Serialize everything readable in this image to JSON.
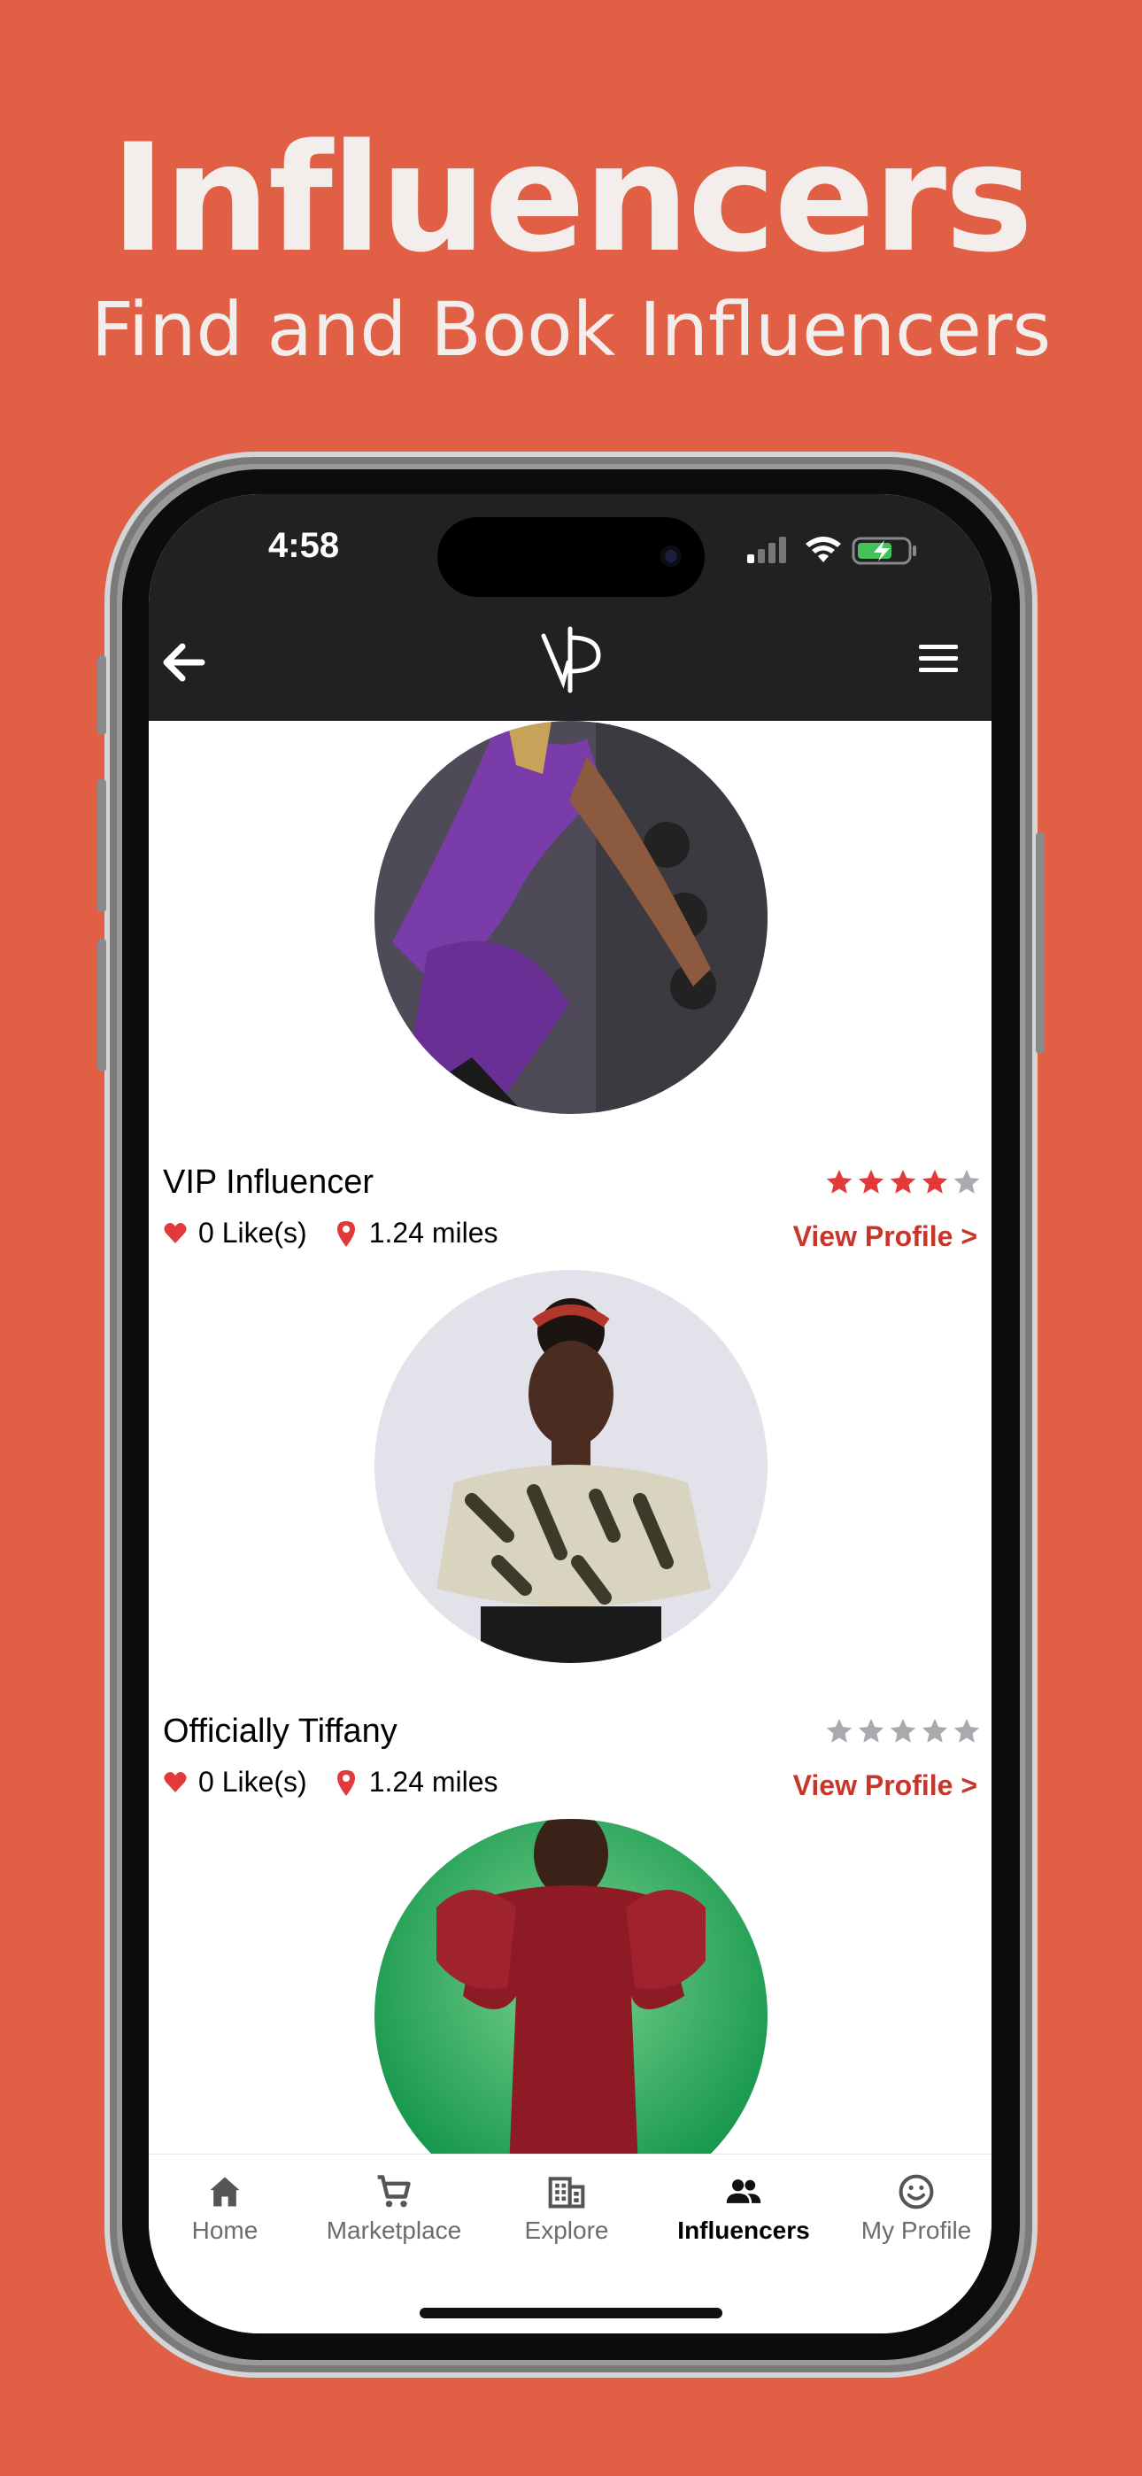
{
  "header": {
    "title": "Influencers",
    "subtitle": "Find and Book Influencers"
  },
  "status_bar": {
    "time": "4:58"
  },
  "nav": {
    "back_icon": "back-arrow-icon",
    "logo_text": "VP",
    "menu_icon": "hamburger-menu-icon"
  },
  "influencers": [
    {
      "name": "VIP Influencer",
      "likes": "0 Like(s)",
      "distance": "1.24 miles",
      "rating": 4,
      "view_profile_label": "View Profile >",
      "avatar_bg": "#5b4a66"
    },
    {
      "name": "Officially Tiffany",
      "likes": "0 Like(s)",
      "distance": "1.24 miles",
      "rating": 0,
      "view_profile_label": "View Profile >",
      "avatar_bg": "#e6e4ee"
    },
    {
      "name": "",
      "avatar_bg": "#1f9e4e"
    }
  ],
  "tabbar": {
    "items": [
      {
        "label": "Home",
        "icon": "home-icon"
      },
      {
        "label": "Marketplace",
        "icon": "cart-icon"
      },
      {
        "label": "Explore",
        "icon": "building-icon"
      },
      {
        "label": "Influencers",
        "icon": "people-icon",
        "active": true
      },
      {
        "label": "My Profile",
        "icon": "smiley-icon"
      }
    ]
  },
  "colors": {
    "background": "#E05F45",
    "accent": "#C7362B",
    "star_active": "#E23A3A",
    "star_inactive": "#A9A9AE",
    "nav_bg": "#212124"
  }
}
